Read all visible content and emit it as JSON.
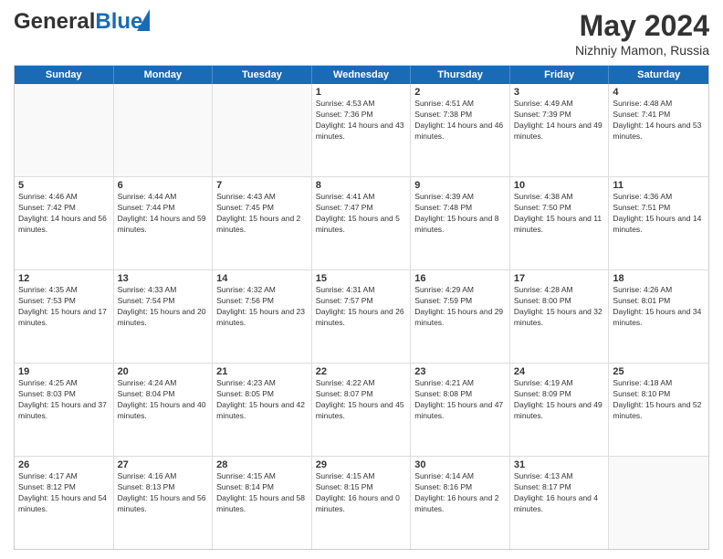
{
  "header": {
    "logo_general": "General",
    "logo_blue": "Blue",
    "main_title": "May 2024",
    "subtitle": "Nizhniy Mamon, Russia"
  },
  "days_of_week": [
    "Sunday",
    "Monday",
    "Tuesday",
    "Wednesday",
    "Thursday",
    "Friday",
    "Saturday"
  ],
  "weeks": [
    [
      {
        "day": "",
        "sunrise": "",
        "sunset": "",
        "daylight": ""
      },
      {
        "day": "",
        "sunrise": "",
        "sunset": "",
        "daylight": ""
      },
      {
        "day": "",
        "sunrise": "",
        "sunset": "",
        "daylight": ""
      },
      {
        "day": "1",
        "sunrise": "Sunrise: 4:53 AM",
        "sunset": "Sunset: 7:36 PM",
        "daylight": "Daylight: 14 hours and 43 minutes."
      },
      {
        "day": "2",
        "sunrise": "Sunrise: 4:51 AM",
        "sunset": "Sunset: 7:38 PM",
        "daylight": "Daylight: 14 hours and 46 minutes."
      },
      {
        "day": "3",
        "sunrise": "Sunrise: 4:49 AM",
        "sunset": "Sunset: 7:39 PM",
        "daylight": "Daylight: 14 hours and 49 minutes."
      },
      {
        "day": "4",
        "sunrise": "Sunrise: 4:48 AM",
        "sunset": "Sunset: 7:41 PM",
        "daylight": "Daylight: 14 hours and 53 minutes."
      }
    ],
    [
      {
        "day": "5",
        "sunrise": "Sunrise: 4:46 AM",
        "sunset": "Sunset: 7:42 PM",
        "daylight": "Daylight: 14 hours and 56 minutes."
      },
      {
        "day": "6",
        "sunrise": "Sunrise: 4:44 AM",
        "sunset": "Sunset: 7:44 PM",
        "daylight": "Daylight: 14 hours and 59 minutes."
      },
      {
        "day": "7",
        "sunrise": "Sunrise: 4:43 AM",
        "sunset": "Sunset: 7:45 PM",
        "daylight": "Daylight: 15 hours and 2 minutes."
      },
      {
        "day": "8",
        "sunrise": "Sunrise: 4:41 AM",
        "sunset": "Sunset: 7:47 PM",
        "daylight": "Daylight: 15 hours and 5 minutes."
      },
      {
        "day": "9",
        "sunrise": "Sunrise: 4:39 AM",
        "sunset": "Sunset: 7:48 PM",
        "daylight": "Daylight: 15 hours and 8 minutes."
      },
      {
        "day": "10",
        "sunrise": "Sunrise: 4:38 AM",
        "sunset": "Sunset: 7:50 PM",
        "daylight": "Daylight: 15 hours and 11 minutes."
      },
      {
        "day": "11",
        "sunrise": "Sunrise: 4:36 AM",
        "sunset": "Sunset: 7:51 PM",
        "daylight": "Daylight: 15 hours and 14 minutes."
      }
    ],
    [
      {
        "day": "12",
        "sunrise": "Sunrise: 4:35 AM",
        "sunset": "Sunset: 7:53 PM",
        "daylight": "Daylight: 15 hours and 17 minutes."
      },
      {
        "day": "13",
        "sunrise": "Sunrise: 4:33 AM",
        "sunset": "Sunset: 7:54 PM",
        "daylight": "Daylight: 15 hours and 20 minutes."
      },
      {
        "day": "14",
        "sunrise": "Sunrise: 4:32 AM",
        "sunset": "Sunset: 7:56 PM",
        "daylight": "Daylight: 15 hours and 23 minutes."
      },
      {
        "day": "15",
        "sunrise": "Sunrise: 4:31 AM",
        "sunset": "Sunset: 7:57 PM",
        "daylight": "Daylight: 15 hours and 26 minutes."
      },
      {
        "day": "16",
        "sunrise": "Sunrise: 4:29 AM",
        "sunset": "Sunset: 7:59 PM",
        "daylight": "Daylight: 15 hours and 29 minutes."
      },
      {
        "day": "17",
        "sunrise": "Sunrise: 4:28 AM",
        "sunset": "Sunset: 8:00 PM",
        "daylight": "Daylight: 15 hours and 32 minutes."
      },
      {
        "day": "18",
        "sunrise": "Sunrise: 4:26 AM",
        "sunset": "Sunset: 8:01 PM",
        "daylight": "Daylight: 15 hours and 34 minutes."
      }
    ],
    [
      {
        "day": "19",
        "sunrise": "Sunrise: 4:25 AM",
        "sunset": "Sunset: 8:03 PM",
        "daylight": "Daylight: 15 hours and 37 minutes."
      },
      {
        "day": "20",
        "sunrise": "Sunrise: 4:24 AM",
        "sunset": "Sunset: 8:04 PM",
        "daylight": "Daylight: 15 hours and 40 minutes."
      },
      {
        "day": "21",
        "sunrise": "Sunrise: 4:23 AM",
        "sunset": "Sunset: 8:05 PM",
        "daylight": "Daylight: 15 hours and 42 minutes."
      },
      {
        "day": "22",
        "sunrise": "Sunrise: 4:22 AM",
        "sunset": "Sunset: 8:07 PM",
        "daylight": "Daylight: 15 hours and 45 minutes."
      },
      {
        "day": "23",
        "sunrise": "Sunrise: 4:21 AM",
        "sunset": "Sunset: 8:08 PM",
        "daylight": "Daylight: 15 hours and 47 minutes."
      },
      {
        "day": "24",
        "sunrise": "Sunrise: 4:19 AM",
        "sunset": "Sunset: 8:09 PM",
        "daylight": "Daylight: 15 hours and 49 minutes."
      },
      {
        "day": "25",
        "sunrise": "Sunrise: 4:18 AM",
        "sunset": "Sunset: 8:10 PM",
        "daylight": "Daylight: 15 hours and 52 minutes."
      }
    ],
    [
      {
        "day": "26",
        "sunrise": "Sunrise: 4:17 AM",
        "sunset": "Sunset: 8:12 PM",
        "daylight": "Daylight: 15 hours and 54 minutes."
      },
      {
        "day": "27",
        "sunrise": "Sunrise: 4:16 AM",
        "sunset": "Sunset: 8:13 PM",
        "daylight": "Daylight: 15 hours and 56 minutes."
      },
      {
        "day": "28",
        "sunrise": "Sunrise: 4:15 AM",
        "sunset": "Sunset: 8:14 PM",
        "daylight": "Daylight: 15 hours and 58 minutes."
      },
      {
        "day": "29",
        "sunrise": "Sunrise: 4:15 AM",
        "sunset": "Sunset: 8:15 PM",
        "daylight": "Daylight: 16 hours and 0 minutes."
      },
      {
        "day": "30",
        "sunrise": "Sunrise: 4:14 AM",
        "sunset": "Sunset: 8:16 PM",
        "daylight": "Daylight: 16 hours and 2 minutes."
      },
      {
        "day": "31",
        "sunrise": "Sunrise: 4:13 AM",
        "sunset": "Sunset: 8:17 PM",
        "daylight": "Daylight: 16 hours and 4 minutes."
      },
      {
        "day": "",
        "sunrise": "",
        "sunset": "",
        "daylight": ""
      }
    ]
  ]
}
